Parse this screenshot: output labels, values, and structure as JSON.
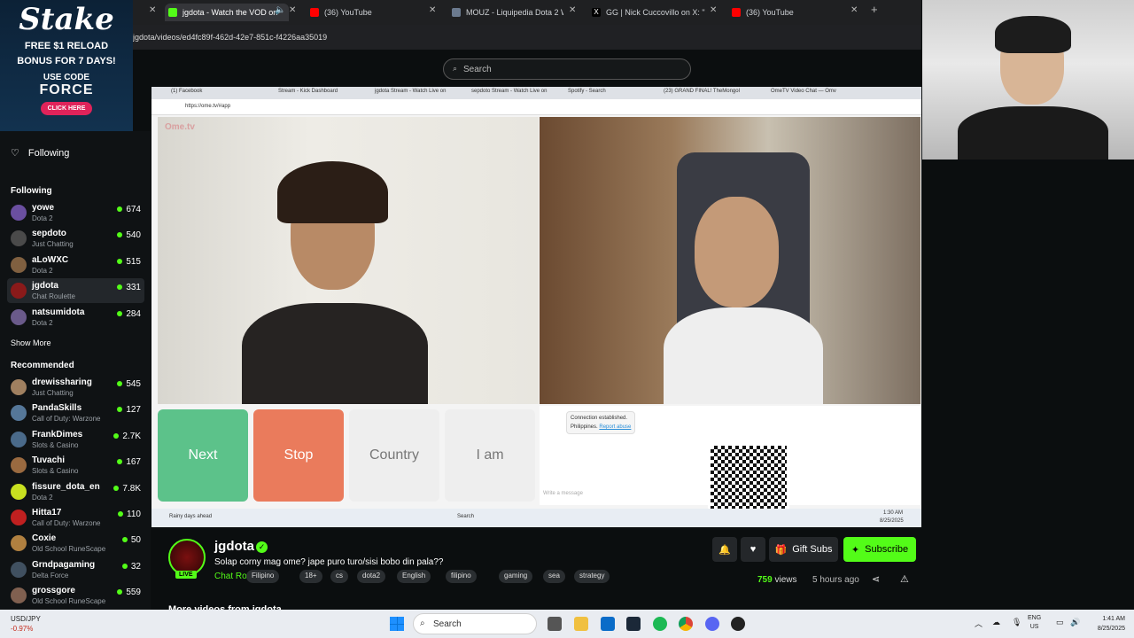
{
  "browser": {
    "tabs": [
      {
        "title": "jgdota - Watch the VOD on",
        "color": "#53fc18",
        "active": true
      },
      {
        "title": "(36) YouTube",
        "color": "#ff0000"
      },
      {
        "title": "MOUZ - Liquipedia Dota 2 Wiki",
        "color": "#6b7a8f"
      },
      {
        "title": "GG | Nick Cuccovillo on X: \"Foll",
        "color": "#ffffff"
      },
      {
        "title": "(36) YouTube",
        "color": "#ff0000"
      }
    ],
    "url": "jgdota/videos/ed4fc89f-462d-42e7-851c-f4226aa35019"
  },
  "ad": {
    "brand": "Stake",
    "line1": "FREE $1 RELOAD",
    "line2": "BONUS FOR 7 DAYS!",
    "code_label": "USE CODE",
    "code": "FORCE",
    "cta": "CLICK HERE"
  },
  "sidebar": {
    "following_link": "Following",
    "following_header": "Following",
    "following": [
      {
        "name": "yowe",
        "category": "Dota 2",
        "viewers": "674",
        "color": "#6a4fa0"
      },
      {
        "name": "sepdoto",
        "category": "Just Chatting",
        "viewers": "540",
        "color": "#4a4a4a"
      },
      {
        "name": "aLoWXC",
        "category": "Dota 2",
        "viewers": "515",
        "color": "#806040"
      },
      {
        "name": "jgdota",
        "category": "Chat Roulette",
        "viewers": "331",
        "color": "#8a1a1a",
        "selected": true
      },
      {
        "name": "natsumidota",
        "category": "Dota 2",
        "viewers": "284",
        "color": "#6a5a8a"
      }
    ],
    "show_more": "Show More",
    "recommended_header": "Recommended",
    "recommended": [
      {
        "name": "drewissharing",
        "category": "Just Chatting",
        "viewers": "545",
        "color": "#a08060"
      },
      {
        "name": "PandaSkills",
        "category": "Call of Duty: Warzone",
        "viewers": "127",
        "color": "#557799"
      },
      {
        "name": "FrankDimes",
        "category": "Slots & Casino",
        "viewers": "2.7K",
        "color": "#4a6a8a"
      },
      {
        "name": "Tuvachi",
        "category": "Slots & Casino",
        "viewers": "167",
        "color": "#9a6a40"
      },
      {
        "name": "fissure_dota_en",
        "category": "Dota 2",
        "viewers": "7.8K",
        "color": "#c8e020"
      },
      {
        "name": "Hitta17",
        "category": "Call of Duty: Warzone",
        "viewers": "110",
        "color": "#c02020"
      },
      {
        "name": "Coxie",
        "category": "Old School RuneScape",
        "viewers": "50",
        "color": "#b08040"
      },
      {
        "name": "Grndpagaming",
        "category": "Delta Force",
        "viewers": "32",
        "color": "#405060"
      },
      {
        "name": "grossgore",
        "category": "Old School RuneScape",
        "viewers": "559",
        "color": "#806050"
      }
    ]
  },
  "search": {
    "placeholder": "Search"
  },
  "stream_view": {
    "inner_tabs": [
      "(1) Facebook",
      "Stream - Kick Dashboard",
      "jgdota Stream - Watch Live on",
      "sepdoto Stream - Watch Live on",
      "Spotify - Search",
      "(23) GRAND FINAL! TheMongol",
      "OmeTV Video Chat — Omv"
    ],
    "inner_url": "https://ome.tv/#app",
    "site_logo": "Ome.tv",
    "buttons": {
      "next": "Next",
      "stop": "Stop",
      "country": "Country",
      "iam": "I am"
    },
    "connection": "Connection established.",
    "country_line": "Philippines.",
    "report": "Report abuse",
    "message_placeholder": "Write a message",
    "weather": "Rainy days ahead",
    "inner_search": "Search",
    "inner_time": "1:30 AM",
    "inner_date": "8/25/2025"
  },
  "stream_info": {
    "streamer": "jgdota",
    "live": "LIVE",
    "title": "Solap corny mag ome? jape puro turo/sisi bobo din pala??",
    "category": "Chat Roulette",
    "tags": [
      "Filipino",
      "18+",
      "cs",
      "dota2",
      "English",
      "filipino",
      "gaming",
      "sea",
      "strategy"
    ],
    "gift_subs": "Gift Subs",
    "subscribe": "Subscribe",
    "views_count": "759",
    "views_label": "views",
    "time_ago": "5 hours ago",
    "more_videos": "More videos from jgdota"
  },
  "taskbar": {
    "ticker_symbol": "USD/JPY",
    "ticker_change": "-0.97%",
    "search": "Search",
    "lang1": "ENG",
    "lang2": "US",
    "time": "1:41 AM",
    "date": "8/25/2025"
  }
}
